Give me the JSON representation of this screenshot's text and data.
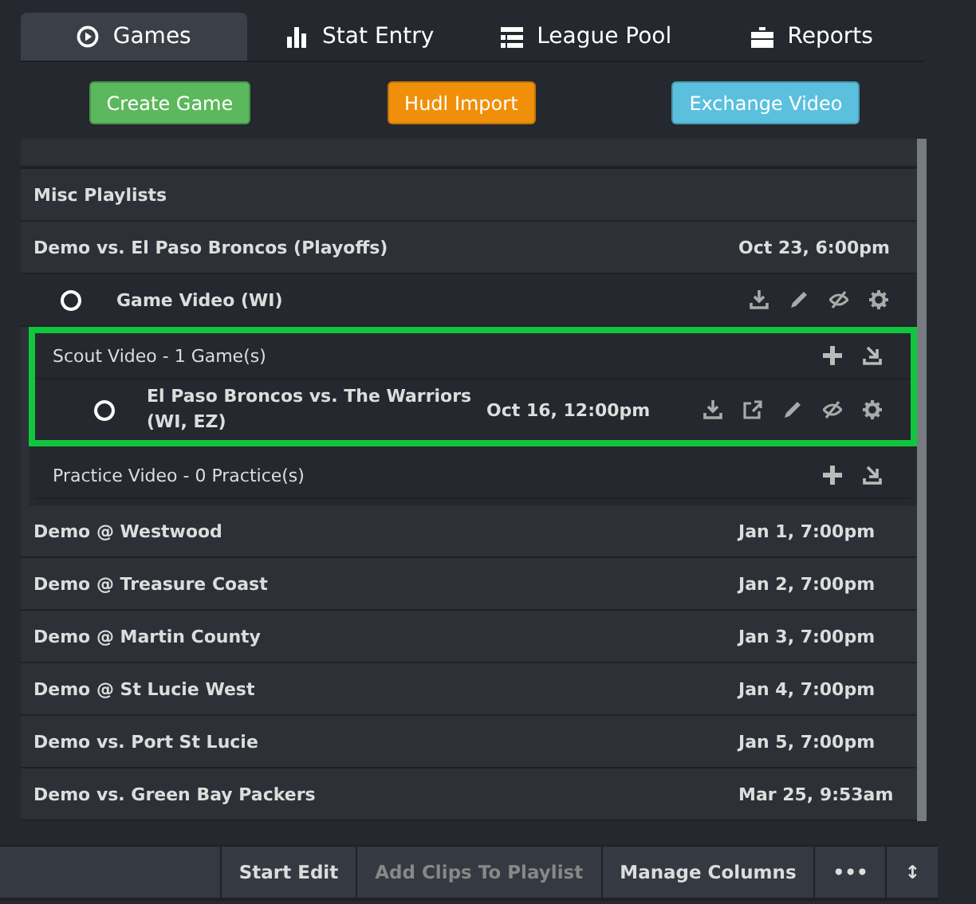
{
  "tabs": [
    {
      "label": "Games",
      "selected": true
    },
    {
      "label": "Stat Entry",
      "selected": false
    },
    {
      "label": "League Pool",
      "selected": false
    },
    {
      "label": "Reports",
      "selected": false
    }
  ],
  "action_buttons": [
    {
      "label": "Create Game",
      "color": "#5cb85c"
    },
    {
      "label": "Hudl Import",
      "color": "#f0900a"
    },
    {
      "label": "Exchange Video",
      "color": "#5bc0de"
    }
  ],
  "rows": [
    {
      "kind": "header",
      "title": "Misc Playlists"
    },
    {
      "kind": "game",
      "title": "Demo vs. El Paso Broncos (Playoffs)",
      "date": "Oct 23, 6:00pm"
    },
    {
      "kind": "video",
      "title": "Game Video (WI)",
      "selected": false
    },
    {
      "kind": "group",
      "label": "Scout Video - 1 Game(s)",
      "highlighted": true,
      "children": [
        {
          "title": "El Paso Broncos vs. The Warriors (WI, EZ)",
          "date": "Oct 16, 12:00pm",
          "selected": false
        }
      ]
    },
    {
      "kind": "group",
      "label": "Practice Video - 0 Practice(s)",
      "highlighted": false,
      "children": []
    },
    {
      "kind": "game",
      "title": "Demo @ Westwood",
      "date": "Jan 1, 7:00pm"
    },
    {
      "kind": "game",
      "title": "Demo @ Treasure Coast",
      "date": "Jan 2, 7:00pm"
    },
    {
      "kind": "game",
      "title": "Demo @ Martin County",
      "date": "Jan 3, 7:00pm"
    },
    {
      "kind": "game",
      "title": "Demo @ St Lucie West",
      "date": "Jan 4, 7:00pm"
    },
    {
      "kind": "game",
      "title": "Demo vs. Port St Lucie",
      "date": "Jan 5, 7:00pm"
    },
    {
      "kind": "game",
      "title": "Demo vs. Green Bay Packers",
      "date": "Mar 25, 9:53am"
    }
  ],
  "toolbar": [
    {
      "label": "Start Edit",
      "disabled": false
    },
    {
      "label": "Add Clips To Playlist",
      "disabled": true
    },
    {
      "label": "Manage Columns",
      "disabled": false
    },
    {
      "label": "•••",
      "disabled": false
    },
    {
      "label": "↕",
      "disabled": false
    }
  ]
}
